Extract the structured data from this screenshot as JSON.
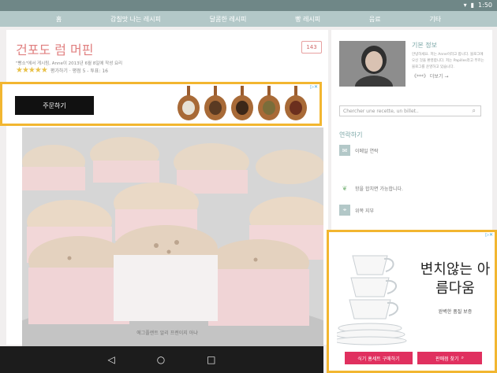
{
  "status_bar": {
    "time": "1:50",
    "wifi_icon": "wifi-icon",
    "battery_icon": "battery-icon"
  },
  "nav": {
    "items": [
      "홈",
      "감칠맛 나는 레시피",
      "달콤한 레시피",
      "빵 레시피",
      "음료",
      "기타"
    ]
  },
  "post": {
    "title": "건포도 럼 머핀",
    "meta": "\"빵소\"에서 게시됨, Anne이 2013년 6월 8일에 작성 요리",
    "stars": "★★★★★",
    "rating_text": "평가하기 · 평점 5 - 투표: 16",
    "comment_count": "143",
    "caption": "에그플랜트 알리 프렌이지 아냐"
  },
  "ad_top": {
    "button_label": "주문하기",
    "ad_choice": "▷✕"
  },
  "sidebar": {
    "profile_title": "기본 정보",
    "profile_text": "안녕하세요. 저는 Anne이라고 합니다. 블로그에 오신 것을 환영합니다. 저는 Papilles라고 부르는 블로그를 운영하고 있습니다.",
    "more_link": "《***》 더보기 →",
    "search_placeholder": "Chercher une recette, un billet..",
    "contact_title": "연락하기",
    "email_label": "이메일 연락",
    "feed_label": "항을 합치면 가능합니다.",
    "location_label": "위쪽 지부"
  },
  "ad_right": {
    "headline": "변치않는 아름다움",
    "subline": "완벽한 품질 보증",
    "button1": "식기 홈세트 구매하기",
    "button2": "판매점 찾기",
    "ad_choice": "▷✕"
  },
  "android_nav": {
    "back": "◁",
    "home": "○",
    "recents": "□"
  }
}
